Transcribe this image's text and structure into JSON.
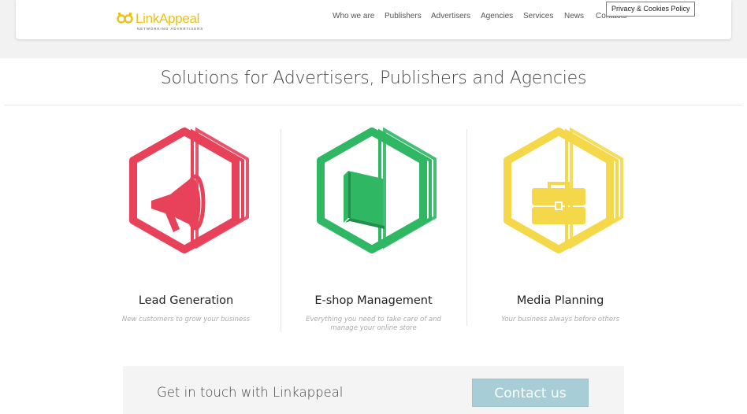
{
  "colors": {
    "brand_yellow": "#e8c21a",
    "red": "#e8415a",
    "green": "#2fb764",
    "yellow": "#f5d84a",
    "cta_button": "#a7cdd6"
  },
  "header": {
    "logo_word": "LinkAppeal",
    "logo_tagline": "NETWORKING ADVERTISERS",
    "nav": [
      "Who we are",
      "Publishers",
      "Advertisers",
      "Agencies",
      "Services",
      "News",
      "Contacts"
    ]
  },
  "cookie_banner": {
    "label": "Privacy & Cookies Policy"
  },
  "main": {
    "title": "Solutions for Advertisers, Publishers and Agencies",
    "services": [
      {
        "title": "Lead Generation",
        "desc": "New customers to grow your business",
        "icon": "megaphone-icon",
        "color": "#e8415a"
      },
      {
        "title": "E-shop Management",
        "desc": "Everything you need to take care of and manage your online store",
        "icon": "book-icon",
        "color": "#2fb764"
      },
      {
        "title": "Media Planning",
        "desc": "Your business always before others",
        "icon": "briefcase-icon",
        "color": "#f5d84a"
      }
    ]
  },
  "cta": {
    "text": "Get in touch with Linkappeal",
    "button": "Contact us"
  }
}
